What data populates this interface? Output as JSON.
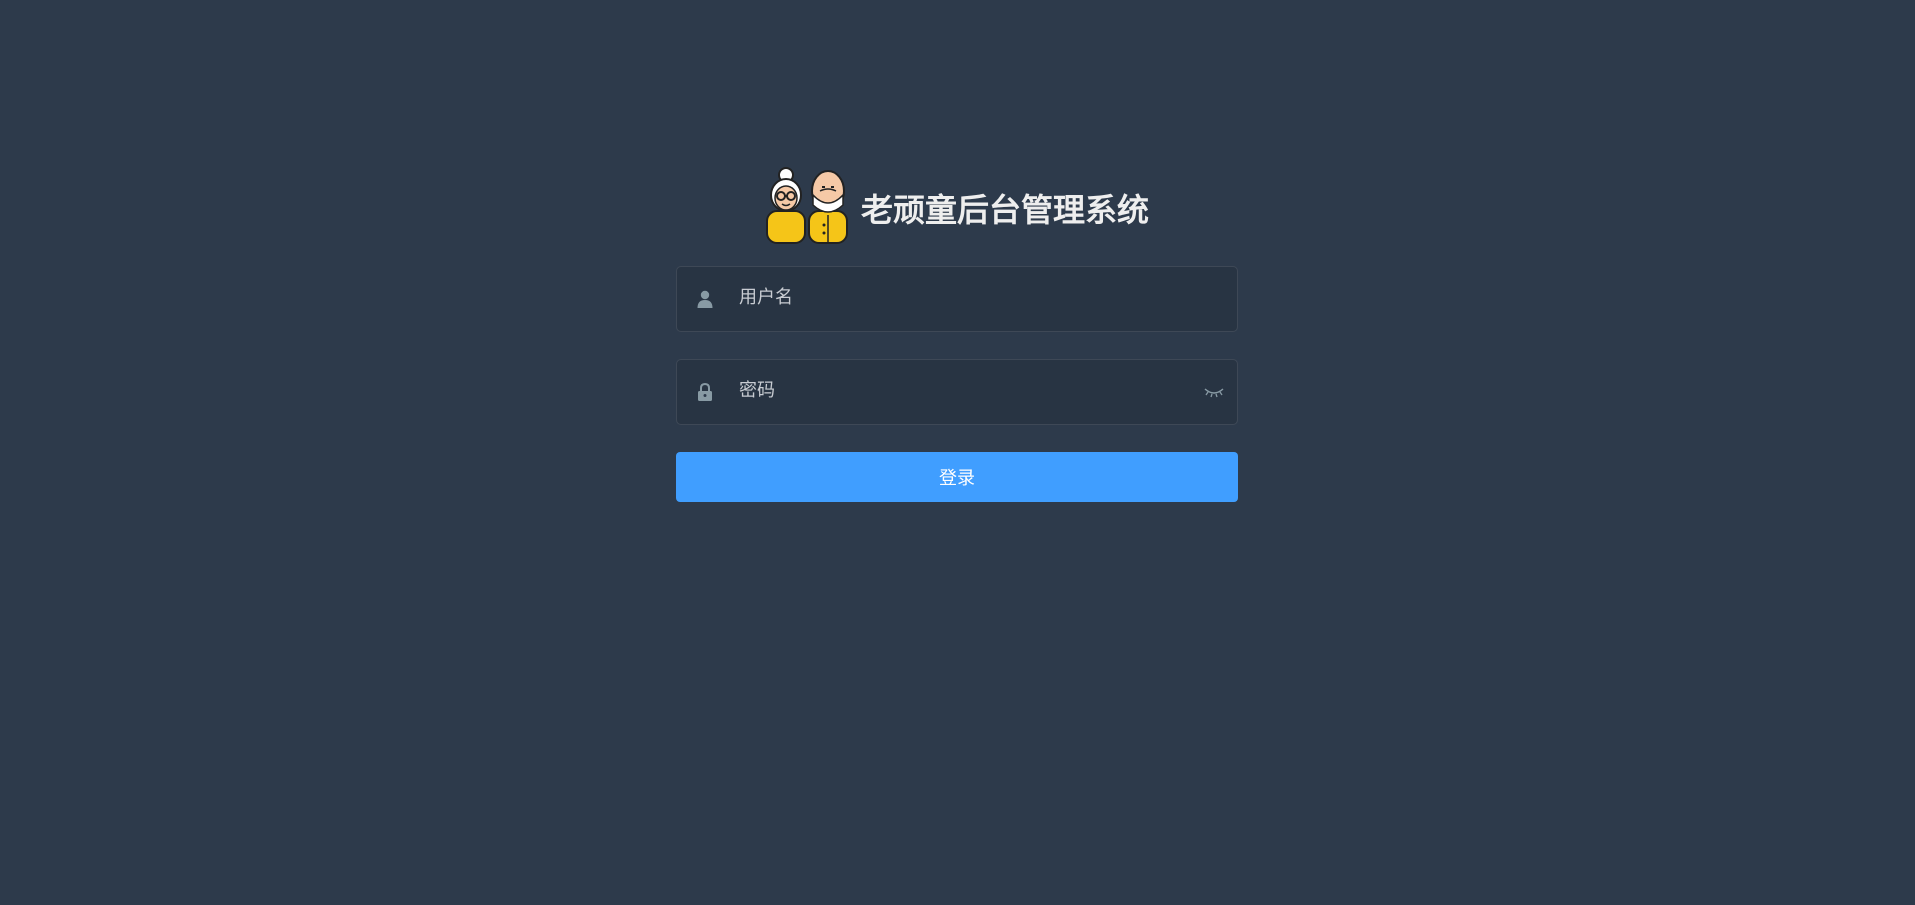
{
  "login": {
    "title": "老顽童后台管理系统",
    "logo_icon": "elderly-couple-icon",
    "username": {
      "placeholder": "用户名",
      "value": "",
      "icon": "user-icon"
    },
    "password": {
      "placeholder": "密码",
      "value": "",
      "icon": "lock-icon",
      "toggle_icon": "eye-closed-icon"
    },
    "submit_label": "登录"
  },
  "colors": {
    "background": "#2d3a4b",
    "button": "#409eff",
    "title": "#eeeeee"
  }
}
